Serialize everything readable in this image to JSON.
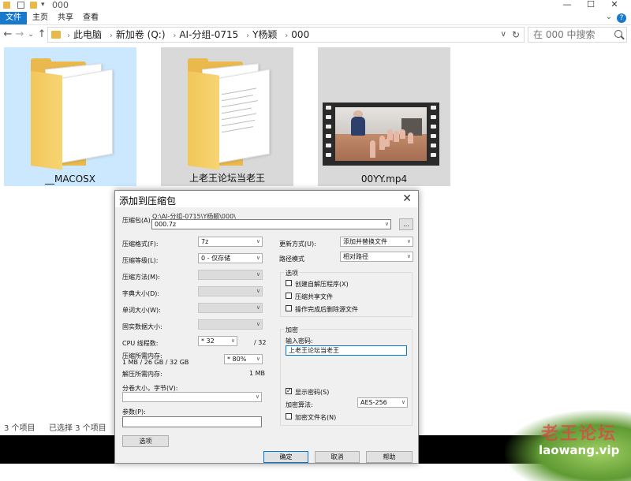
{
  "window": {
    "title": "000",
    "controls": {
      "minimize": "—",
      "maximize": "☐",
      "close": "✕"
    }
  },
  "ribbon": {
    "tabs": [
      "文件",
      "主页",
      "共享",
      "查看"
    ],
    "help": "?"
  },
  "address": {
    "breadcrumbs": [
      "此电脑",
      "新加卷 (Q:)",
      "AI-分组-0715",
      "Y杨颖",
      "000"
    ],
    "search_placeholder": "在 000 中搜索"
  },
  "files": [
    {
      "name": "__MACOSX",
      "type": "folder",
      "selected": true
    },
    {
      "name": "上老王论坛当老王",
      "type": "folder",
      "selected": false
    },
    {
      "name": "00YY.mp4",
      "type": "video",
      "selected": false
    }
  ],
  "status": {
    "items": "3 个项目",
    "selected": "已选择 3 个项目"
  },
  "watermark": {
    "cn": "老王论坛",
    "url": "laowang.vip"
  },
  "dialog": {
    "title": "添加到压缩包",
    "archive_label": "压缩包(A):",
    "archive_path": "Q:\\AI-分组-0715\\Y杨颖\\000\\",
    "archive_name": "000.7z",
    "browse": "...",
    "left_rows": [
      {
        "label": "压缩格式(F):",
        "value": "7z",
        "disabled": false
      },
      {
        "label": "压缩等级(L):",
        "value": "0 - 仅存储",
        "disabled": false
      },
      {
        "label": "压缩方法(M):",
        "value": "",
        "disabled": true
      },
      {
        "label": "字典大小(D):",
        "value": "",
        "disabled": true
      },
      {
        "label": "单词大小(W):",
        "value": "",
        "disabled": true
      },
      {
        "label": "固实数据大小:",
        "value": "",
        "disabled": true
      }
    ],
    "cpu_label": "CPU 线程数:",
    "cpu_value": "* 32",
    "cpu_total": "/ 32",
    "mem_label": "压缩所需内存:",
    "mem_detail": "1 MB / 26 GB / 32 GB",
    "mem_percent": "* 80%",
    "decomp_mem_label": "解压所需内存:",
    "decomp_mem_value": "1 MB",
    "split_label": "分卷大小，字节(V):",
    "params_label": "参数(P):",
    "options_button": "选项",
    "update_label": "更新方式(U):",
    "update_value": "添加并替换文件",
    "path_label": "路径模式",
    "path_value": "相对路径",
    "options_group": "选项",
    "options": [
      {
        "label": "创建自解压程序(X)",
        "checked": false
      },
      {
        "label": "压缩共享文件",
        "checked": false
      },
      {
        "label": "操作完成后删除源文件",
        "checked": false
      }
    ],
    "encrypt_group": "加密",
    "password_label": "输入密码:",
    "password_value": "上老王论坛当老王",
    "show_password": "显示密码(S)",
    "show_password_checked": true,
    "method_label": "加密算法:",
    "method_value": "AES-256",
    "encrypt_names": "加密文件名(N)",
    "encrypt_names_checked": false,
    "buttons": {
      "ok": "确定",
      "cancel": "取消",
      "help": "帮助"
    }
  }
}
